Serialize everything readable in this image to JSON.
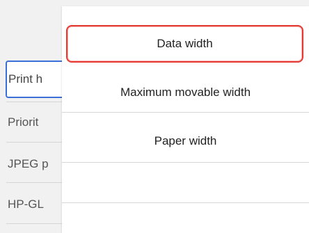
{
  "background_list": {
    "items": [
      {
        "label": "Print h"
      },
      {
        "label": "Priorit"
      },
      {
        "label": "JPEG p"
      },
      {
        "label": "HP-GL"
      }
    ]
  },
  "popup_menu": {
    "items": [
      {
        "label": "Data width",
        "selected": true
      },
      {
        "label": "Maximum movable width",
        "selected": false
      },
      {
        "label": "Paper width",
        "selected": false
      }
    ]
  },
  "colors": {
    "selection_border": "#e33a33",
    "background_selection_border": "#3b6fd8"
  }
}
